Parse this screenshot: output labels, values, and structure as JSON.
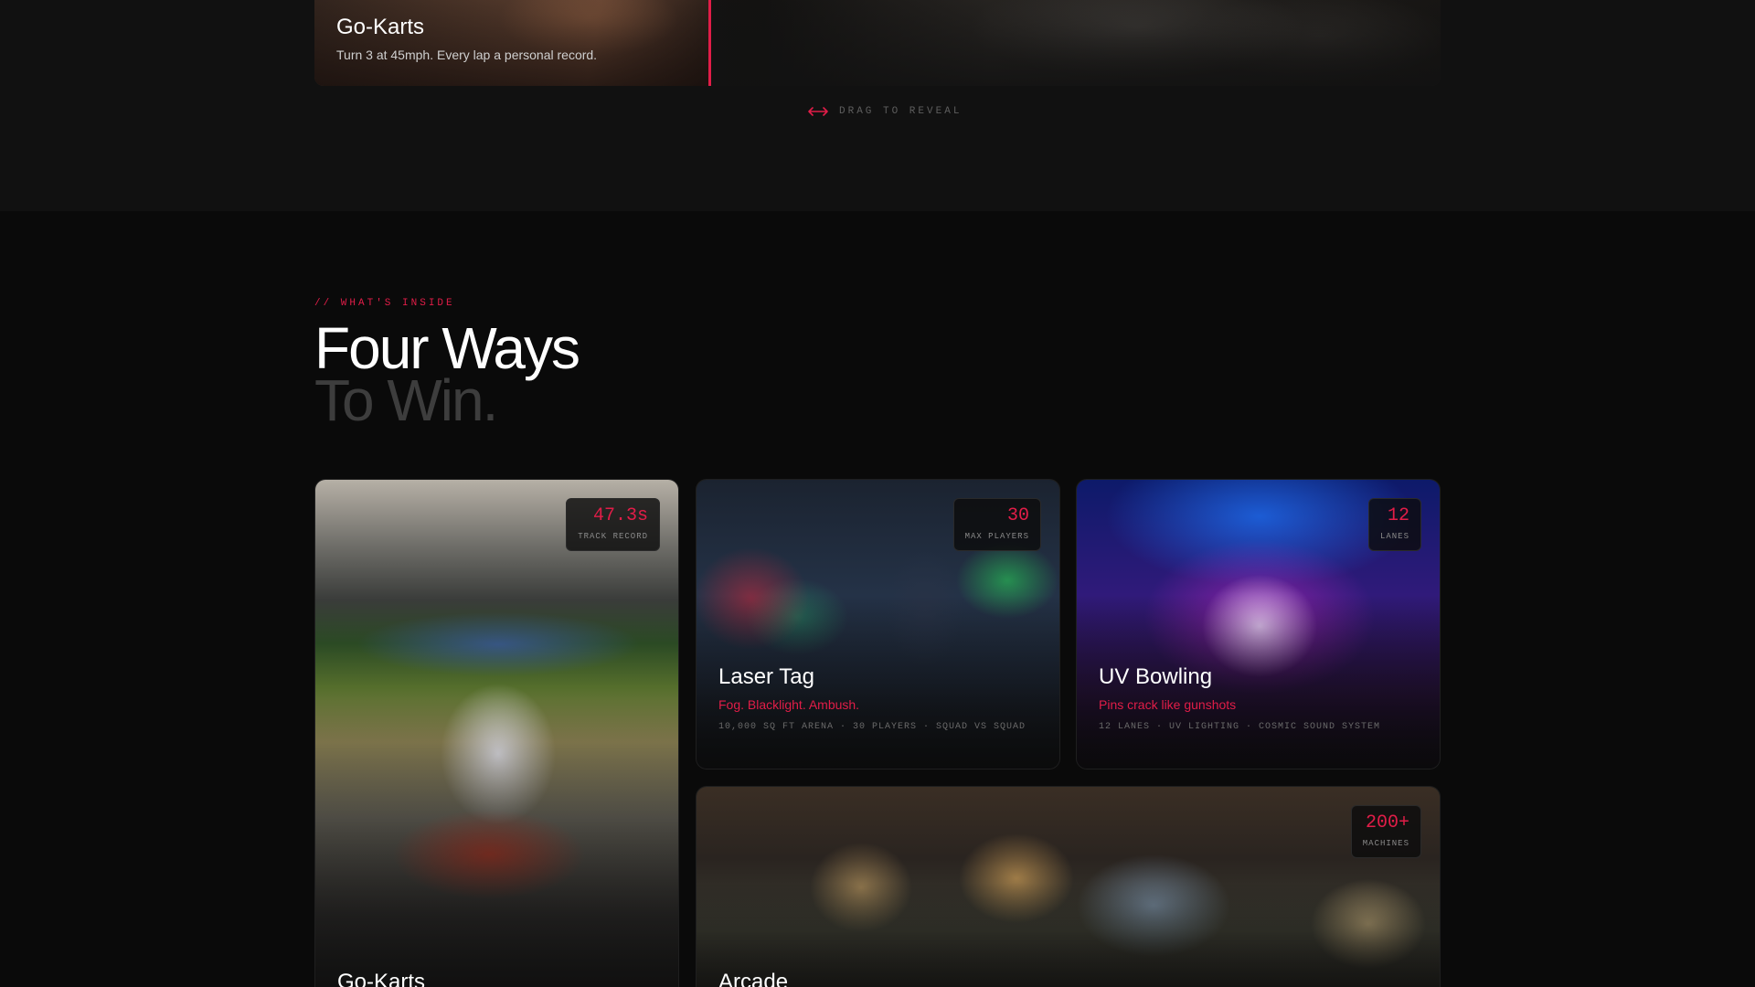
{
  "reveal": {
    "title": "Go-Karts",
    "subtitle": "Turn 3 at 45mph. Every lap a personal record.",
    "drag_hint": "DRAG TO REVEAL",
    "accent": "#e11d48"
  },
  "section": {
    "eyebrow": "// WHAT'S INSIDE",
    "heading_line1": "Four Ways",
    "heading_line2": "To Win."
  },
  "cards": [
    {
      "title": "Go-Karts",
      "stat_value": "47.3s",
      "stat_label": "TRACK RECORD"
    },
    {
      "title": "Laser Tag",
      "tagline": "Fog. Blacklight. Ambush.",
      "specs": "10,000 SQ FT ARENA · 30 PLAYERS · SQUAD VS SQUAD",
      "stat_value": "30",
      "stat_label": "MAX PLAYERS"
    },
    {
      "title": "UV Bowling",
      "tagline": "Pins crack like gunshots",
      "specs": "12 LANES · UV LIGHTING · COSMIC SOUND SYSTEM",
      "stat_value": "12",
      "stat_label": "LANES"
    },
    {
      "title": "Arcade",
      "stat_value": "200+",
      "stat_label": "MACHINES"
    }
  ]
}
